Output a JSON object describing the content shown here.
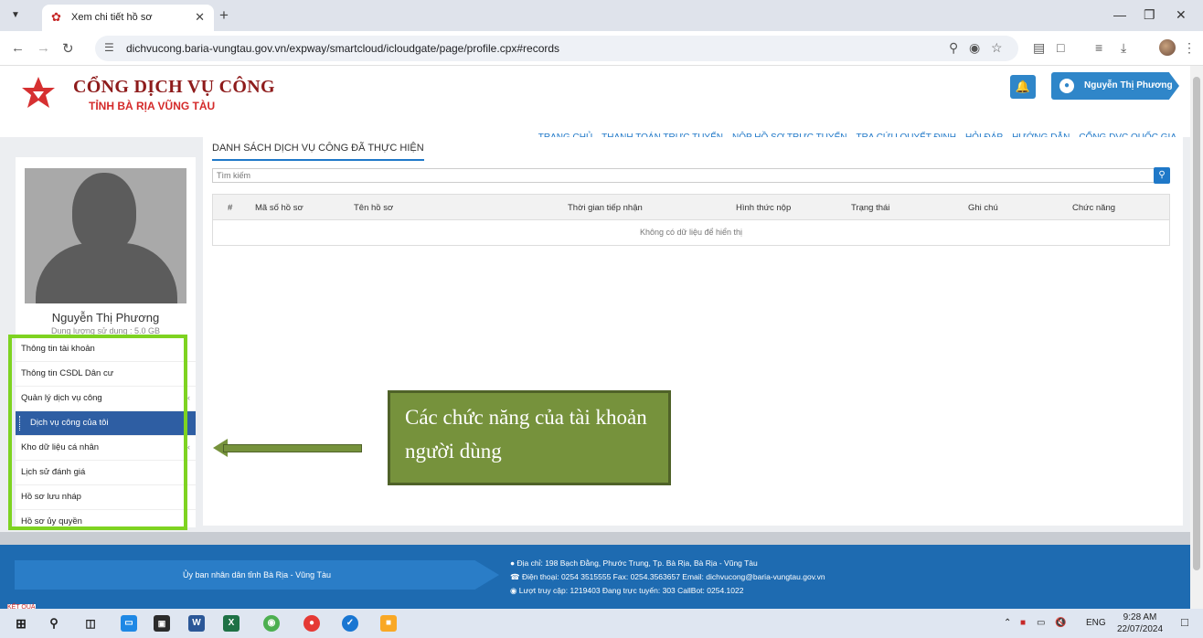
{
  "browser": {
    "tab_title": "Xem chi tiết hồ sơ",
    "url": "dichvucong.baria-vungtau.gov.vn/expway/smartcloud/icloudgate/page/profile.cpx#records"
  },
  "site": {
    "title_line1": "CỔNG DỊCH VỤ CÔNG",
    "title_line2": "TỈNH BÀ RỊA VŨNG TÀU",
    "user_name": "Nguyễn Thị Phương",
    "nav": [
      "TRANG CHỦ",
      "THANH TOÁN TRỰC TUYẾN",
      "NỘP HỒ SƠ TRỰC TUYẾN",
      "TRA CỨU QUYẾT ĐỊNH",
      "HỎI ĐÁP",
      "HƯỚNG DẪN",
      "CỔNG DVC QUỐC GIA"
    ]
  },
  "profile": {
    "name": "Nguyễn Thị Phương",
    "quota": "Dung lượng sử dụng : 5.0 GB"
  },
  "menu": [
    "Thông tin tài khoản",
    "Thông tin CSDL Dân cư",
    "Quản lý dịch vụ công",
    "Dịch vụ công của tôi",
    "Kho dữ liệu cá nhân",
    "Lịch sử đánh giá",
    "Hồ sơ lưu nháp",
    "Hồ sơ ủy quyền"
  ],
  "main": {
    "title": "DANH SÁCH DỊCH VỤ CÔNG ĐÃ THỰC HIỆN",
    "search_placeholder": "Tìm kiếm",
    "columns": [
      "#",
      "Mã số hồ sơ",
      "Tên hồ sơ",
      "Thời gian tiếp nhận",
      "Hình thức nộp",
      "Trạng thái",
      "Ghi chú",
      "Chức năng"
    ],
    "empty_text": "Không có dữ liệu để hiển thị"
  },
  "annotation": {
    "text": "Các chức năng của tài khoản người dùng",
    "color": "#76923c"
  },
  "footer": {
    "org": "Ủy ban nhân dân tỉnh Bà Rịa - Vũng Tàu",
    "address": "Địa chỉ: 198 Bạch Đằng, Phước Trung, Tp. Bà Rịa, Bà Rịa - Vũng Tàu",
    "contact": "Điện thoại: 0254 3515555  Fax: 0254.3563657  Email: dichvucong@baria-vungtau.gov.vn",
    "stats": "Lượt truy cập: 1219403    Đang trực tuyến: 303    CallBot: 0254.1022",
    "corner": "KẾT QUẢ"
  },
  "taskbar": {
    "lang": "ENG",
    "time": "9:28 AM",
    "date": "22/07/2024"
  }
}
